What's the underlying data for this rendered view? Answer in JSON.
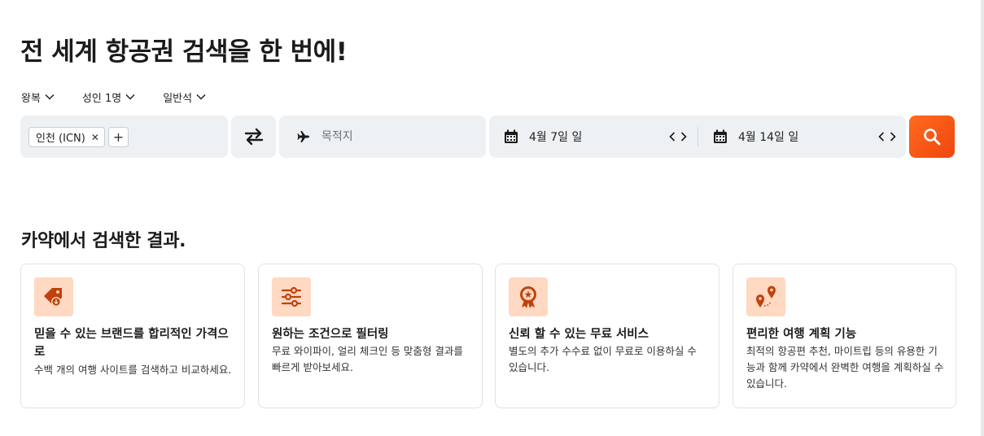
{
  "header": {
    "title": "전 세계 항공권 검색을 한 번에!"
  },
  "options": {
    "trip_type": "왕복",
    "passengers": "성인 1명",
    "cabin": "일반석"
  },
  "search": {
    "origin_chip": "인천 (ICN)",
    "origin_chip_remove": "✕",
    "add_origin": "+",
    "destination_placeholder": "목적지",
    "depart_date": "4월 7일 일",
    "return_date": "4월 14일 일",
    "prev": "‹",
    "next": "›"
  },
  "results": {
    "title": "카약에서 검색한 결과.",
    "cards": [
      {
        "icon": "price-tag-icon",
        "title": "믿을 수 있는 브랜드를 합리적인 가격으로",
        "desc": "수백 개의 여행 사이트를 검색하고 비교하세요."
      },
      {
        "icon": "filter-sliders-icon",
        "title": "원하는 조건으로 필터링",
        "desc": "무료 와이파이, 얼리 체크인 등 맞춤형 결과를 빠르게 받아보세요."
      },
      {
        "icon": "award-badge-icon",
        "title": "신뢰 할 수 있는 무료 서비스",
        "desc": "별도의 추가 수수료 없이 무료로 이용하실 수 있습니다."
      },
      {
        "icon": "map-pins-icon",
        "title": "편리한 여행 계획 기능",
        "desc": "최적의 항공편 추천, 마이트립 등의 유용한 기능과 함께 카약에서 완벽한 여행을 계획하실 수 있습니다."
      }
    ]
  },
  "colors": {
    "accent": "#f4511e",
    "icon_bg": "#ffd9c2",
    "icon_fg": "#c2410c",
    "field_bg": "#edf1f4"
  }
}
